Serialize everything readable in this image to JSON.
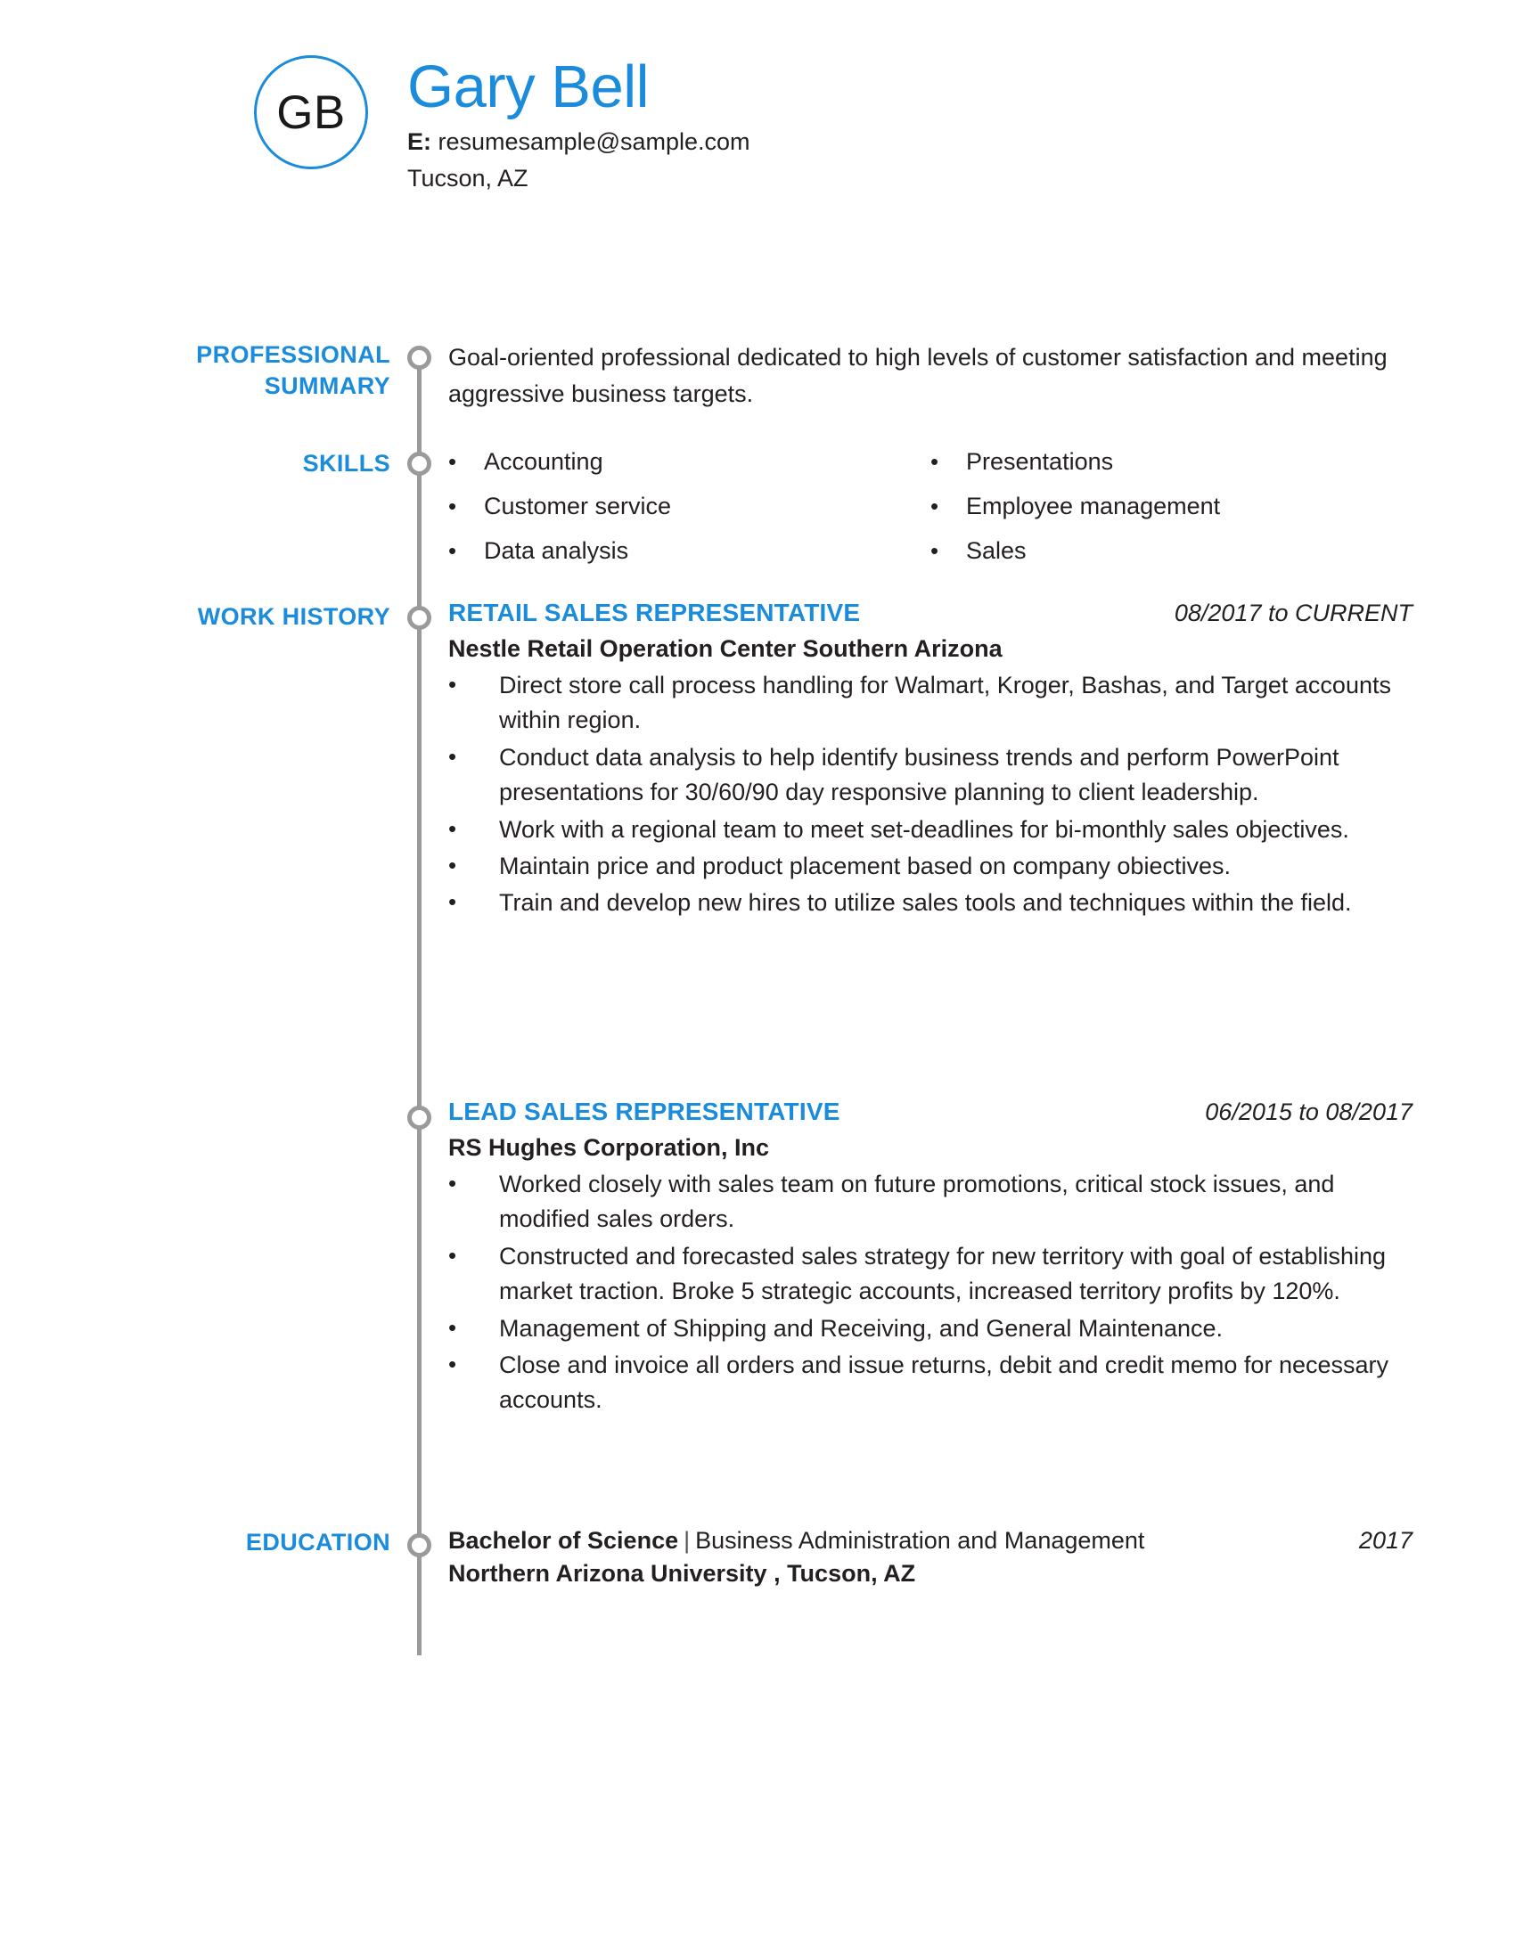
{
  "theme": {
    "accent": "#1a8cdb",
    "text": "#231f20",
    "timeline": "#9a9a9a"
  },
  "header": {
    "initials": "GB",
    "name": "Gary Bell",
    "email_label": "E:",
    "email": "resumesample@sample.com",
    "location": "Tucson, AZ"
  },
  "sections": {
    "summary": {
      "label": "PROFESSIONAL SUMMARY",
      "text": "Goal-oriented professional dedicated to high levels of customer satisfaction and meeting aggressive business targets."
    },
    "skills": {
      "label": "SKILLS",
      "column_left": [
        "Accounting",
        "Customer service",
        "Data analysis"
      ],
      "column_right": [
        "Presentations",
        "Employee management",
        "Sales"
      ]
    },
    "work_history": {
      "label": "WORK HISTORY",
      "jobs": [
        {
          "title": "RETAIL SALES REPRESENTATIVE",
          "dates": "08/2017 to CURRENT",
          "company": "Nestle Retail Operation Center Southern Arizona",
          "bullets": [
            "Direct store call process handling for Walmart, Kroger, Bashas, and Target accounts within region.",
            "Conduct data analysis to help identify business trends and perform PowerPoint presentations for 30/60/90 day responsive planning to client leadership.",
            "Work with a regional team to meet set-deadlines for bi-monthly sales objectives.",
            "Maintain price and product placement based on company obiectives.",
            "Train and develop new hires to utilize sales tools and techniques within the field."
          ]
        },
        {
          "title": "LEAD SALES REPRESENTATIVE",
          "dates": "06/2015 to 08/2017",
          "company": "RS Hughes Corporation, Inc",
          "bullets": [
            "Worked closely with sales team on future promotions, critical stock issues, and modified sales orders.",
            "Constructed and forecasted sales strategy for new territory with goal of establishing market traction. Broke 5 strategic accounts, increased territory profits by 120%.",
            "Management of Shipping and Receiving, and General Maintenance.",
            "Close and invoice all orders and issue returns, debit and credit memo for necessary accounts."
          ]
        }
      ]
    },
    "education": {
      "label": "EDUCATION",
      "degree": "Bachelor of Science",
      "separator": "|",
      "field": "Business Administration and Management",
      "year": "2017",
      "school": "Northern Arizona University , Tucson, AZ"
    }
  },
  "icons": {
    "bullet": "•"
  }
}
